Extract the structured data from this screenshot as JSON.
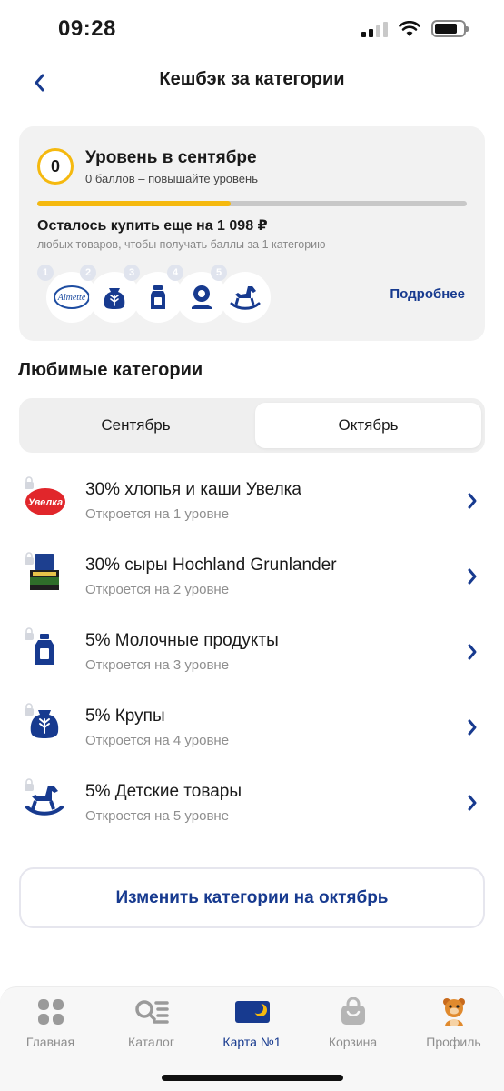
{
  "status_bar": {
    "time": "09:28"
  },
  "header": {
    "title": "Кешбэк за категории",
    "back_icon": "chevron-left-icon"
  },
  "level_card": {
    "level_value": "0",
    "title": "Уровень в сентябре",
    "subtitle": "0 баллов – повышайте уровень",
    "progress_fraction": 0.45,
    "remaining_title": "Осталось купить еще на 1 098 ₽",
    "remaining_subtitle": "любых товаров, чтобы получать баллы за 1 категорию",
    "levels": [
      {
        "num": "1",
        "icon": "almette-logo"
      },
      {
        "num": "2",
        "icon": "grain-sack-icon"
      },
      {
        "num": "3",
        "icon": "milk-bottle-icon"
      },
      {
        "num": "4",
        "icon": "flower-pin-icon"
      },
      {
        "num": "5",
        "icon": "rocking-horse-icon"
      }
    ],
    "more_link": "Подробнее"
  },
  "favorites": {
    "title": "Любимые категории",
    "tabs": [
      {
        "label": "Сентябрь",
        "selected": false
      },
      {
        "label": "Октябрь",
        "selected": true
      }
    ],
    "categories": [
      {
        "title": "30% хлопья и каши Увелка",
        "subtitle": "Откроется на 1 уровне",
        "icon": "uvelka-logo"
      },
      {
        "title": "30% сыры Hochland Grunlander",
        "subtitle": "Откроется на 2 уровне",
        "icon": "grunlander-logo"
      },
      {
        "title": "5% Молочные продукты",
        "subtitle": "Откроется на 3 уровне",
        "icon": "milk-bottle-icon"
      },
      {
        "title": "5% Крупы",
        "subtitle": "Откроется на 4 уровне",
        "icon": "grain-sack-icon"
      },
      {
        "title": "5% Детские товары",
        "subtitle": "Откроется на 5 уровне",
        "icon": "rocking-horse-icon"
      }
    ]
  },
  "change_button": {
    "label": "Изменить категории на октябрь"
  },
  "tab_bar": {
    "items": [
      {
        "label": "Главная",
        "icon": "home-tiles-icon",
        "active": false
      },
      {
        "label": "Каталог",
        "icon": "catalog-search-icon",
        "active": false
      },
      {
        "label": "Карта №1",
        "icon": "loyalty-card-icon",
        "active": true
      },
      {
        "label": "Корзина",
        "icon": "shopping-bag-icon",
        "active": false
      },
      {
        "label": "Профиль",
        "icon": "profile-mascot-icon",
        "active": false
      }
    ]
  },
  "colors": {
    "brand_blue": "#173a8f",
    "accent_yellow": "#f5b90f",
    "card_bg": "#f2f2f2"
  }
}
